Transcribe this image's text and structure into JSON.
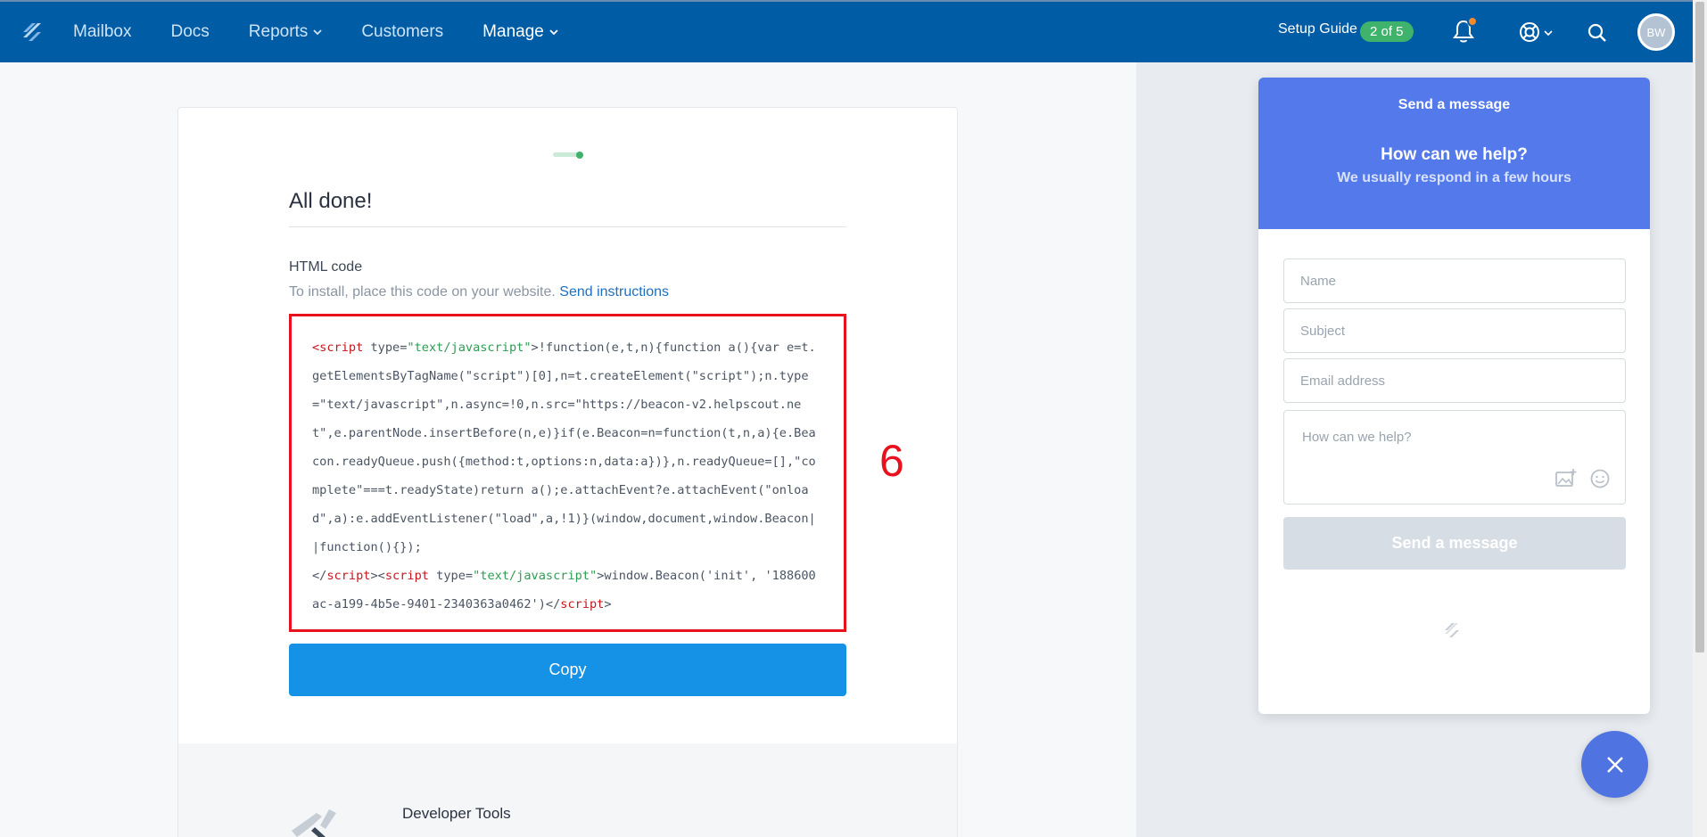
{
  "nav": {
    "items": [
      {
        "label": "Mailbox",
        "has_dropdown": false,
        "active": false
      },
      {
        "label": "Docs",
        "has_dropdown": false,
        "active": false
      },
      {
        "label": "Reports",
        "has_dropdown": true,
        "active": false
      },
      {
        "label": "Customers",
        "has_dropdown": false,
        "active": false
      },
      {
        "label": "Manage",
        "has_dropdown": true,
        "active": true
      }
    ],
    "setup_guide_label": "Setup Guide",
    "setup_guide_progress": "2 of 5",
    "avatar_initials": "BW",
    "icons": [
      "helpscout-logo-icon",
      "bell-icon",
      "lifebuoy-icon",
      "search-icon"
    ]
  },
  "main": {
    "title": "All done!",
    "html_code_label": "HTML code",
    "install_hint": "To install, place this code on your website.",
    "send_instructions_link": "Send instructions",
    "annotation_number": "6",
    "copy_button": "Copy",
    "dev_tools_title": "Developer Tools",
    "code_lines": [
      [
        [
          "tag",
          "<script"
        ],
        [
          "plain",
          " type="
        ],
        [
          "str",
          "\"text/javascript\""
        ],
        [
          "plain",
          ">!function(e,t,n){function a(){var e=t."
        ]
      ],
      [
        [
          "plain",
          "getElementsByTagName(\"script\")[0],n=t.createElement(\"script\");n.type"
        ]
      ],
      [
        [
          "plain",
          "=\"text/javascript\",n.async=!0,n.src=\"https://beacon-v2.helpscout.ne"
        ]
      ],
      [
        [
          "plain",
          "t\",e.parentNode.insertBefore(n,e)}if(e.Beacon=n=function(t,n,a){e.Bea"
        ]
      ],
      [
        [
          "plain",
          "con.readyQueue.push({method:t,options:n,data:a})},n.readyQueue=[],\"co"
        ]
      ],
      [
        [
          "plain",
          "mplete\"===t.readyState)return a();e.attachEvent?e.attachEvent(\"onloa"
        ]
      ],
      [
        [
          "plain",
          "d\",a):e.addEventListener(\"load\",a,!1)}(window,document,window.Beacon|"
        ]
      ],
      [
        [
          "plain",
          "|function(){});"
        ]
      ],
      [
        [
          "plain",
          "</"
        ],
        [
          "tag",
          "script"
        ],
        [
          "plain",
          "><"
        ],
        [
          "tag",
          "script"
        ],
        [
          "plain",
          " type="
        ],
        [
          "str",
          "\"text/javascript\""
        ],
        [
          "plain",
          ">window.Beacon('init', '188600"
        ]
      ],
      [
        [
          "plain",
          "ac-a199-4b5e-9401-2340363a0462')</"
        ],
        [
          "tag",
          "script"
        ],
        [
          "plain",
          ">"
        ]
      ]
    ]
  },
  "beacon": {
    "header_title": "Send a message",
    "question": "How can we help?",
    "subtitle": "We usually respond in a few hours",
    "name_placeholder": "Name",
    "subject_placeholder": "Subject",
    "email_placeholder": "Email address",
    "message_placeholder": "How can we help?",
    "send_button": "Send a message"
  },
  "colors": {
    "topbar": "#005ca4",
    "accent_blue": "#1592e6",
    "beacon_blue": "#5379ea",
    "badge_green": "#3fb36b",
    "annotation_red": "#e8121e"
  }
}
